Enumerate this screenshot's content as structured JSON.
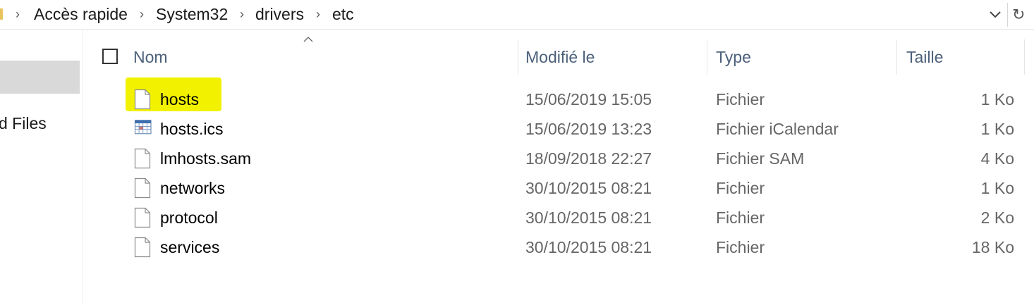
{
  "address_bar": {
    "breadcrumbs": [
      "Accès rapide",
      "System32",
      "drivers",
      "etc"
    ],
    "dropdown_icon": "chevron-down-icon",
    "refresh_icon": "refresh-icon"
  },
  "nav_pane": {
    "partial_item_label": "d Files"
  },
  "columns": {
    "name": "Nom",
    "modified": "Modifié le",
    "type": "Type",
    "size": "Taille"
  },
  "files": [
    {
      "name": "hosts",
      "modified": "15/06/2019 15:05",
      "type": "Fichier",
      "size": "1 Ko",
      "icon": "document-icon",
      "highlighted": true
    },
    {
      "name": "hosts.ics",
      "modified": "15/06/2019 13:23",
      "type": "Fichier iCalendar",
      "size": "1 Ko",
      "icon": "calendar-icon"
    },
    {
      "name": "lmhosts.sam",
      "modified": "18/09/2018 22:27",
      "type": "Fichier SAM",
      "size": "4 Ko",
      "icon": "document-icon"
    },
    {
      "name": "networks",
      "modified": "30/10/2015 08:21",
      "type": "Fichier",
      "size": "1 Ko",
      "icon": "document-icon"
    },
    {
      "name": "protocol",
      "modified": "30/10/2015 08:21",
      "type": "Fichier",
      "size": "2 Ko",
      "icon": "document-icon"
    },
    {
      "name": "services",
      "modified": "30/10/2015 08:21",
      "type": "Fichier",
      "size": "18 Ko",
      "icon": "document-icon"
    }
  ],
  "colors": {
    "highlight": "#f2f200",
    "header_text": "#4c607a",
    "selected_nav": "#d9d9d9"
  }
}
